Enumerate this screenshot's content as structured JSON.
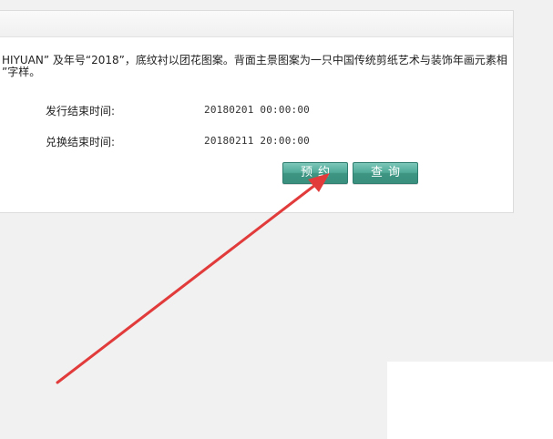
{
  "description": {
    "line1": "HIYUAN” 及年号“2018”，底纹衬以团花图案。背面主景图案为一只中国传统剪纸艺术与装饰年画元素相",
    "line2": "”字样。"
  },
  "fields": [
    {
      "label": "发行结束时间:",
      "value": "20180201 00:00:00"
    },
    {
      "label": "兑换结束时间:",
      "value": "20180211 20:00:00"
    }
  ],
  "buttons": {
    "reserve_label": "预约",
    "query_label": "查询"
  },
  "colors": {
    "button": "#4fa996",
    "arrow": "#e23b3b"
  }
}
